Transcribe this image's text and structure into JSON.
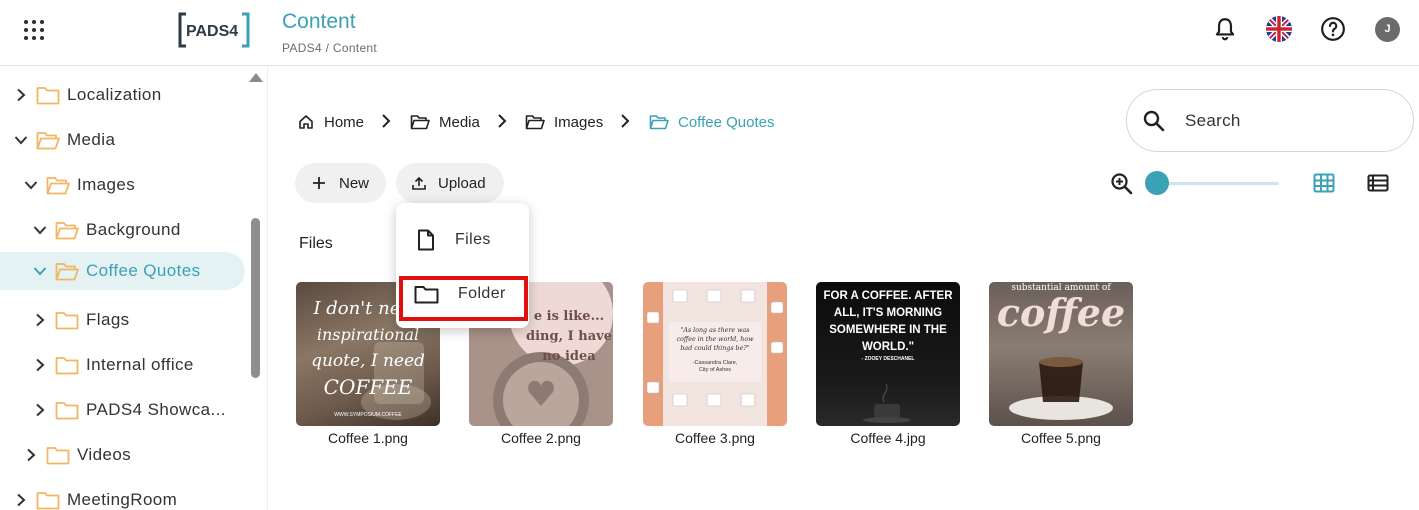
{
  "header": {
    "logo_text": "PADS4",
    "title": "Content",
    "breadcrumb": [
      "PADS4",
      "/",
      "Content"
    ],
    "avatar_initial": "J"
  },
  "sidebar": {
    "items": [
      {
        "label": "Localization",
        "state": "collapsed",
        "level": 0
      },
      {
        "label": "Media",
        "state": "expanded",
        "level": 0
      },
      {
        "label": "Images",
        "state": "expanded",
        "level": 1
      },
      {
        "label": "Background",
        "state": "expanded",
        "level": 2
      },
      {
        "label": "Coffee Quotes",
        "state": "expanded",
        "level": 2,
        "selected": true
      },
      {
        "label": "Flags",
        "state": "collapsed",
        "level": 2
      },
      {
        "label": "Internal office",
        "state": "collapsed",
        "level": 2
      },
      {
        "label": "PADS4 Showca...",
        "state": "collapsed",
        "level": 2
      },
      {
        "label": "Videos",
        "state": "collapsed",
        "level": 1
      },
      {
        "label": "MeetingRoom",
        "state": "collapsed",
        "level": 0
      }
    ]
  },
  "breadcrumb": {
    "home": "Home",
    "media": "Media",
    "images": "Images",
    "current": "Coffee Quotes"
  },
  "search": {
    "label": "Search"
  },
  "toolbar": {
    "new_label": "New",
    "upload_label": "Upload"
  },
  "upload_menu": {
    "files_label": "Files",
    "folder_label": "Folder"
  },
  "files_section": {
    "label": "Files"
  },
  "files": [
    {
      "name": "Coffee 1.png",
      "text_lines": [
        "I don't need",
        "inspirational",
        "quote, I need",
        "COFFEE"
      ],
      "footer": "WWW.SYMPOSIUM.COFFEE"
    },
    {
      "name": "Coffee 2.png",
      "text_lines": [
        "e is like...",
        "ding, I have",
        "no idea"
      ]
    },
    {
      "name": "Coffee 3.png",
      "text_lines": [
        "\"As long as there was",
        "coffee in the world, how",
        "bad could things be?\"",
        "-Cassandra Clare,",
        "City of Ashes"
      ]
    },
    {
      "name": "Coffee 4.jpg",
      "text_lines": [
        "FOR A COFFEE. AFTER",
        "ALL, IT'S MORNING",
        "SOMEWHERE IN THE",
        "WORLD.\"",
        "- ZOOEY DESCHANEL"
      ]
    },
    {
      "name": "Coffee 5.png",
      "text_lines": [
        "substantial amount of",
        "coffee"
      ]
    }
  ],
  "colors": {
    "accent": "#3aa2b4",
    "folder": "#f0b660",
    "highlight": "#e01010",
    "selected_bg": "#e5f2f4"
  }
}
